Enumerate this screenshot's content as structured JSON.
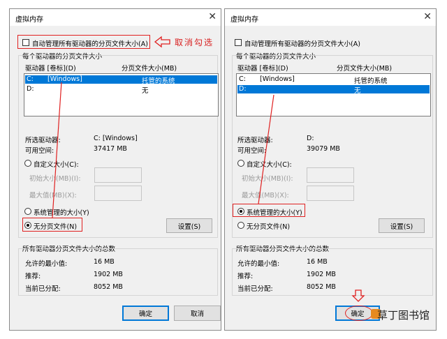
{
  "left": {
    "title": "虚拟内存",
    "auto_manage_label": "自动管理所有驱动器的分页文件大小(A)",
    "group_title": "每个驱动器的分页文件大小",
    "col_drive": "驱动器 [卷标](D)",
    "col_size": "分页文件大小(MB)",
    "drives": [
      {
        "drive": "C:",
        "label": "[Windows]",
        "size": "托管的系统"
      },
      {
        "drive": "D:",
        "label": "",
        "size": "无"
      }
    ],
    "selected_drive_label": "所选驱动器:",
    "selected_drive_value": "C:  [Windows]",
    "free_space_label": "可用空间:",
    "free_space_value": "37417 MB",
    "custom_size_label": "自定义大小(C):",
    "initial_size_label": "初始大小(MB)(I):",
    "max_size_label": "最大值(MB)(X):",
    "system_managed_label": "系统管理的大小(Y)",
    "no_paging_label": "无分页文件(N)",
    "set_button": "设置(S)",
    "total_title": "所有驱动器分页文件大小的总数",
    "min_allowed_label": "允许的最小值:",
    "min_allowed_value": "16 MB",
    "recommended_label": "推荐:",
    "recommended_value": "1902 MB",
    "current_label": "当前已分配:",
    "current_value": "8052 MB",
    "ok_button": "确定",
    "cancel_button": "取消"
  },
  "right": {
    "title": "虚拟内存",
    "auto_manage_label": "自动管理所有驱动器的分页文件大小(A)",
    "group_title": "每个驱动器的分页文件大小",
    "col_drive": "驱动器 [卷标](D)",
    "col_size": "分页文件大小(MB)",
    "drives": [
      {
        "drive": "C:",
        "label": "[Windows]",
        "size": "托管的系统"
      },
      {
        "drive": "D:",
        "label": "",
        "size": "无"
      }
    ],
    "selected_drive_label": "所选驱动器:",
    "selected_drive_value": "D:",
    "free_space_label": "可用空间:",
    "free_space_value": "39079 MB",
    "custom_size_label": "自定义大小(C):",
    "initial_size_label": "初始大小(MB)(I):",
    "max_size_label": "最大值(MB)(X):",
    "system_managed_label": "系统管理的大小(Y)",
    "no_paging_label": "无分页文件(N)",
    "set_button": "设置(S)",
    "total_title": "所有驱动器分页文件大小的总数",
    "min_allowed_label": "允许的最小值:",
    "min_allowed_value": "16 MB",
    "recommended_label": "推荐:",
    "recommended_value": "1902 MB",
    "current_label": "当前已分配:",
    "current_value": "8052 MB",
    "ok_button": "确定"
  },
  "annotation": "取消勾选",
  "watermark": "草丁图书馆",
  "annotation_color": "#e02020",
  "selection_color": "#0078d7"
}
